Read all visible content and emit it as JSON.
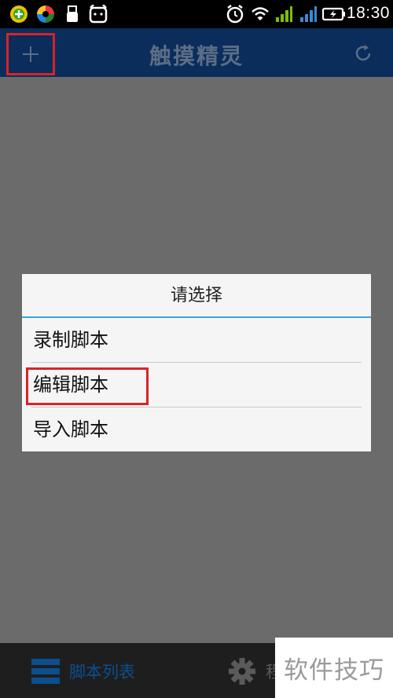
{
  "status_bar": {
    "time": "18:30",
    "icons": [
      "app-green-icon",
      "app-multicolor-icon",
      "usb-icon",
      "notification-face-icon",
      "alarm-icon",
      "wifi-icon",
      "signal-icon",
      "signal-icon-2",
      "battery-charging-icon"
    ]
  },
  "app_bar": {
    "title": "触摸精灵",
    "add_icon": "plus-icon",
    "refresh_icon": "refresh-icon"
  },
  "dialog": {
    "title": "请选择",
    "items": [
      {
        "label": "录制脚本"
      },
      {
        "label": "编辑脚本"
      },
      {
        "label": "导入脚本"
      }
    ]
  },
  "bottom_bar": {
    "tabs": [
      {
        "label": "脚本列表",
        "icon": "list-icon"
      },
      {
        "label": "程",
        "icon": "gear-icon"
      }
    ]
  },
  "watermark": {
    "text": "软件技巧"
  },
  "colors": {
    "app_bar": "#0a2d5c",
    "overlay": "#6b6b6b",
    "highlight": "#d8232a",
    "dialog_accent": "#3aa6d6"
  }
}
